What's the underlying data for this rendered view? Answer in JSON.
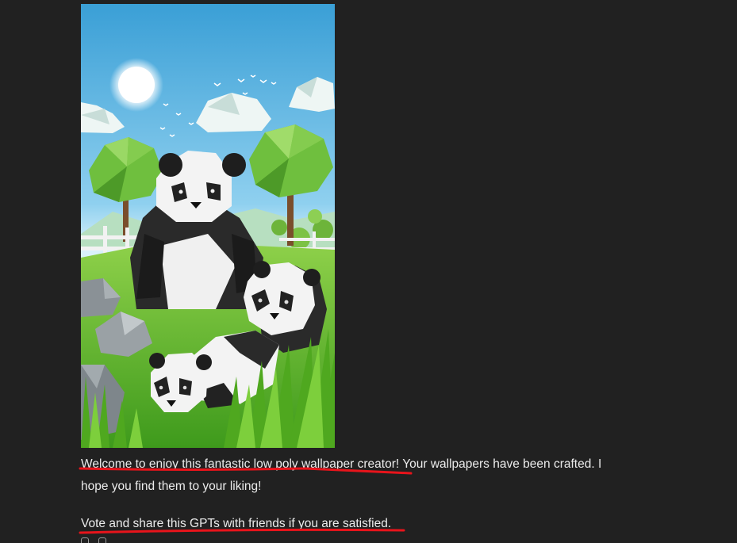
{
  "message": {
    "intro_underlined": "Welcome to enjoy this fantastic low poly wallpaper creator!",
    "intro_rest_line1": " Your wallpapers have been crafted. I",
    "intro_line2": "hope you find them to your liking!",
    "vote_line": "Vote and share this GPTs with friends if you are satisfied."
  },
  "colors": {
    "background": "#212121",
    "text": "#ececec",
    "underline": "#e8141b",
    "sky_top": "#3a9fd6",
    "grass": "#5fb52a"
  },
  "icons": [
    "copy-icon",
    "speaker-icon"
  ]
}
